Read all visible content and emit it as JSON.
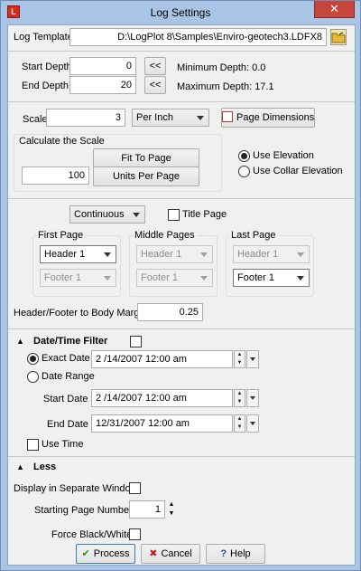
{
  "window": {
    "title": "Log Settings",
    "close": "✕"
  },
  "log_template": {
    "label": "Log Template",
    "value": "D:\\LogPlot 8\\Samples\\Enviro-geotech3.LDFX8"
  },
  "depth": {
    "start_label": "Start Depth",
    "start_value": "0",
    "end_label": "End Depth",
    "end_value": "20",
    "set_button": "<<",
    "min_label": "Minimum Depth: 0.0",
    "max_label": "Maximum Depth: 17.1"
  },
  "scale": {
    "label": "Scale",
    "value": "3",
    "unit": "Per Inch",
    "page_dims_button": "Page Dimensions",
    "calc_group": "Calculate the Scale",
    "fit_button": "Fit To Page",
    "units_value": "100",
    "units_button": "Units Per Page",
    "use_elevation": "Use Elevation",
    "use_collar": "Use Collar Elevation"
  },
  "pages": {
    "mode": "Continuous",
    "title_page": "Title Page",
    "first_page": {
      "label": "First Page",
      "header": "Header 1",
      "footer": "Footer 1"
    },
    "middle_pages": {
      "label": "Middle Pages",
      "header": "Header 1",
      "footer": "Footer 1"
    },
    "last_page": {
      "label": "Last Page",
      "header": "Header 1",
      "footer": "Footer 1"
    },
    "margin_label": "Header/Footer to Body Margin",
    "margin_value": "0.25"
  },
  "date_filter": {
    "title": "Date/Time Filter",
    "exact_label": "Exact Date",
    "exact_value": "2 /14/2007 12:00 am",
    "range_label": "Date Range",
    "start_label": "Start Date",
    "start_value": "2 /14/2007 12:00 am",
    "end_label": "End Date",
    "end_value": "12/31/2007 12:00 am",
    "use_time": "Use Time"
  },
  "less": {
    "title": "Less",
    "separate_window": "Display in Separate Window",
    "start_page_label": "Starting Page Number",
    "start_page_value": "1",
    "force_bw": "Force Black/White"
  },
  "buttons": {
    "process": "Process",
    "cancel": "Cancel",
    "help": "Help"
  }
}
